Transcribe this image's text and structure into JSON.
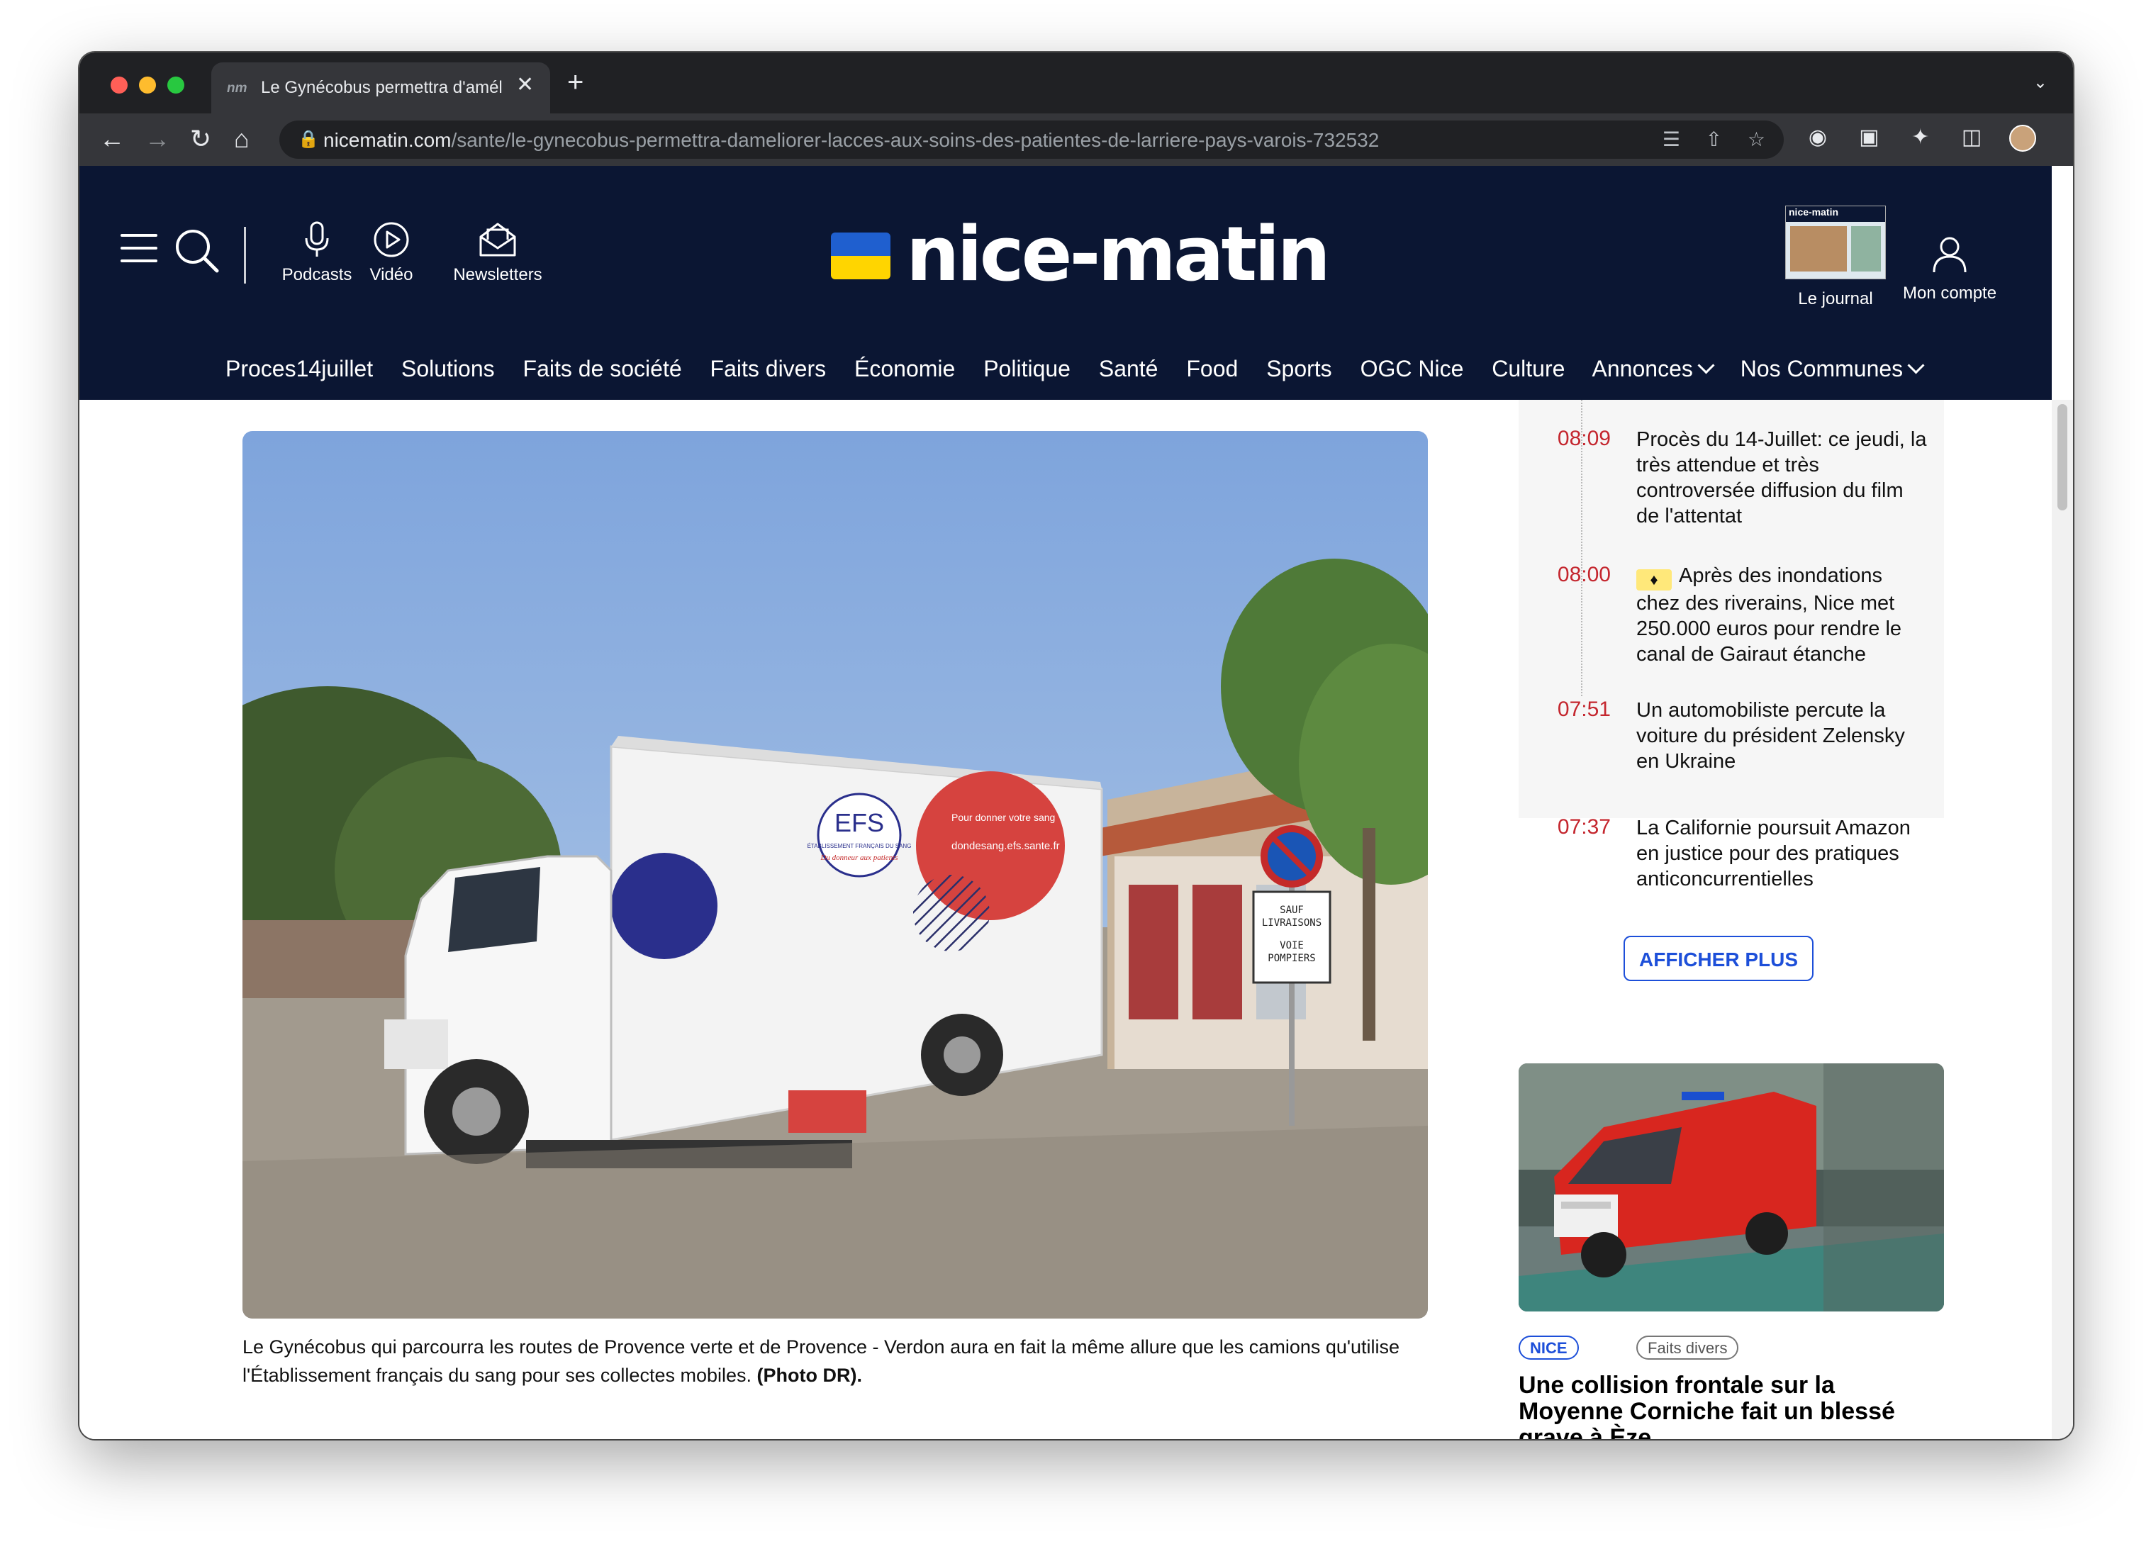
{
  "browser": {
    "tab_title": "Le Gynécobus permettra d'améliorer l'accès aux soins des patientes de l'arrière-pays varois",
    "tab_favicon": "nm",
    "url_host": "nicematin.com",
    "url_path": "/sante/le-gynecobus-permettra-dameliorer-lacces-aux-soins-des-patientes-de-larriere-pays-varois-732532",
    "new_tab_label": "+",
    "close_label": "✕"
  },
  "header": {
    "logo_text": "nice-matin",
    "flag_colors": [
      "#1f5fcf",
      "#ffd500"
    ],
    "icons": [
      {
        "name": "podcasts",
        "label": "Podcasts"
      },
      {
        "name": "video",
        "label": "Vidéo"
      },
      {
        "name": "newsletters",
        "label": "Newsletters"
      }
    ],
    "journal_label": "Le journal",
    "journal_masthead": "nice-matin",
    "account_label": "Mon compte"
  },
  "nav": {
    "items": [
      "Proces14juillet",
      "Solutions",
      "Faits de société",
      "Faits divers",
      "Économie",
      "Politique",
      "Santé",
      "Food",
      "Sports",
      "OGC Nice",
      "Culture",
      "Annonces",
      "Nos Communes"
    ]
  },
  "article": {
    "photo_texts": {
      "efs_logo": "EFS",
      "efs_small": "ÉTABLISSEMENT FRANÇAIS DU SANG",
      "efs_slogan": "Du donneur aux patients",
      "circle_text": "Pour donner votre sang",
      "circle_url": "dondesang.efs.sante.fr",
      "sign_lines": [
        "SAUF",
        "LIVRAISONS",
        "VOIE",
        "POMPIERS"
      ]
    },
    "caption": "Le Gynécobus qui parcourra les routes de Provence verte et de Provence - Verdon aura en fait la même allure que les camions qu'utilise l'Établissement français du sang pour ses collectes mobiles.",
    "caption_credit": "(Photo DR)."
  },
  "live": {
    "items": [
      {
        "time": "08:09",
        "text": "Procès du 14-Juillet: ce jeudi, la très attendue et très controversée diffusion du film de l'attentat",
        "premium": false
      },
      {
        "time": "08:00",
        "text": "Après des inondations chez des riverains, Nice met 250.000 euros pour rendre le canal de Gairaut étanche",
        "premium": true
      },
      {
        "time": "07:51",
        "text": "Un automobiliste percute la voiture du président Zelensky en Ukraine",
        "premium": false
      },
      {
        "time": "07:37",
        "text": "La Californie poursuit Amazon en justice pour des pratiques anticoncurrentielles",
        "premium": false
      }
    ],
    "more_label": "AFFICHER PLUS"
  },
  "card": {
    "tags": [
      "NICE",
      "Faits divers"
    ],
    "title": "Une collision frontale sur la Moyenne Corniche fait un blessé grave à Èze"
  },
  "colors": {
    "header_bg": "#0b1633",
    "accent_blue": "#1d4fd9",
    "time_red": "#c4262e"
  }
}
